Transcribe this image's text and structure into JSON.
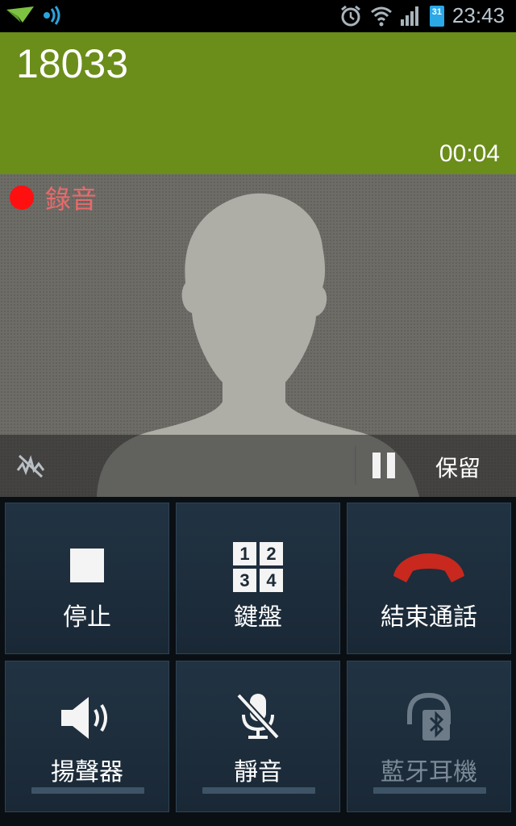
{
  "status_bar": {
    "time": "23:43",
    "battery_calendar_day": "31"
  },
  "call": {
    "number": "18033",
    "duration": "00:04"
  },
  "recording": {
    "label": "錄音"
  },
  "controls": {
    "hold_label": "保留"
  },
  "buttons": [
    {
      "label": "停止",
      "icon": "stop-icon"
    },
    {
      "label": "鍵盤",
      "icon": "keypad-icon",
      "digits": [
        "1",
        "2",
        "3",
        "4"
      ]
    },
    {
      "label": "結束通話",
      "icon": "end-call-icon"
    },
    {
      "label": "揚聲器",
      "icon": "speaker-icon"
    },
    {
      "label": "靜音",
      "icon": "mute-mic-icon"
    },
    {
      "label": "藍牙耳機",
      "icon": "bluetooth-headset-icon"
    }
  ],
  "colors": {
    "header_bg": "#6b8d1a",
    "record_dot": "#ff1010",
    "end_call": "#c8281d"
  }
}
